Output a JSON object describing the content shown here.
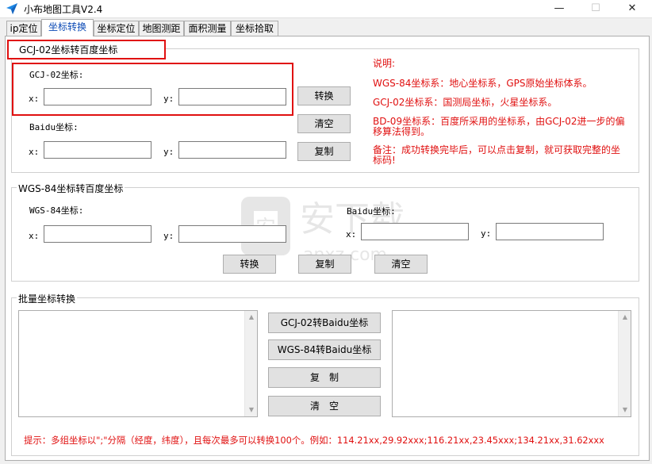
{
  "window": {
    "title": "小布地图工具V2.4",
    "minimize": "—",
    "maximize": "☐",
    "close": "✕"
  },
  "tabs": [
    {
      "label": "ip定位",
      "active": false
    },
    {
      "label": "坐标转换",
      "active": true
    },
    {
      "label": "坐标定位",
      "active": false
    },
    {
      "label": "地图测距",
      "active": false
    },
    {
      "label": "面积测量",
      "active": false
    },
    {
      "label": "坐标拾取",
      "active": false
    }
  ],
  "gcj_section": {
    "title": "GCJ-02坐标转百度坐标",
    "gcj_label": "GCJ-02坐标:",
    "baidu_label": "Baidu坐标:",
    "x_label": "x:",
    "y_label": "y:",
    "gcj_x": "",
    "gcj_y": "",
    "baidu_x": "",
    "baidu_y": "",
    "convert_button": "转换",
    "clear_button": "清空",
    "copy_button": "复制"
  },
  "notes": {
    "heading": "说明:",
    "wgs84": "WGS-84坐标系：地心坐标系，GPS原始坐标体系。",
    "gcj02": "GCJ-02坐标系：国测局坐标，火星坐标系。",
    "bd09_line1": "BD-09坐标系：百度所采用的坐标系，由GCJ-02进一步的偏",
    "bd09_line2": "移算法得到。",
    "remark_line1": "备注：成功转换完毕后，可以点击复制，就可获取完整的坐",
    "remark_line2": "标码!"
  },
  "wgs_section": {
    "title": "WGS-84坐标转百度坐标",
    "wgs_label": "WGS-84坐标:",
    "baidu_label": "Baidu坐标:",
    "x_label": "x:",
    "y_label": "y:",
    "wgs_x": "",
    "wgs_y": "",
    "baidu_x": "",
    "baidu_y": "",
    "convert_button": "转换",
    "copy_button": "复制",
    "clear_button": "清空"
  },
  "batch_section": {
    "title": "批量坐标转换",
    "input_text": "",
    "output_text": "",
    "gcj_to_baidu_button": "GCJ-02转Baidu坐标",
    "wgs_to_baidu_button": "WGS-84转Baidu坐标",
    "copy_button": "复　制",
    "clear_button": "清　空",
    "hint": "提示：多组坐标以\";\"分隔（经度，纬度），且每次最多可以转换100个。例如：114.21xx,29.92xxx;116.21xx,23.45xxx;134.21xx,31.62xxx"
  },
  "watermark": {
    "text": "安下载",
    "subtext": "anxz.com"
  },
  "colors": {
    "accent_red": "#e01010",
    "active_tab_text": "#0a49b5",
    "app_icon": "#1e88e5"
  }
}
